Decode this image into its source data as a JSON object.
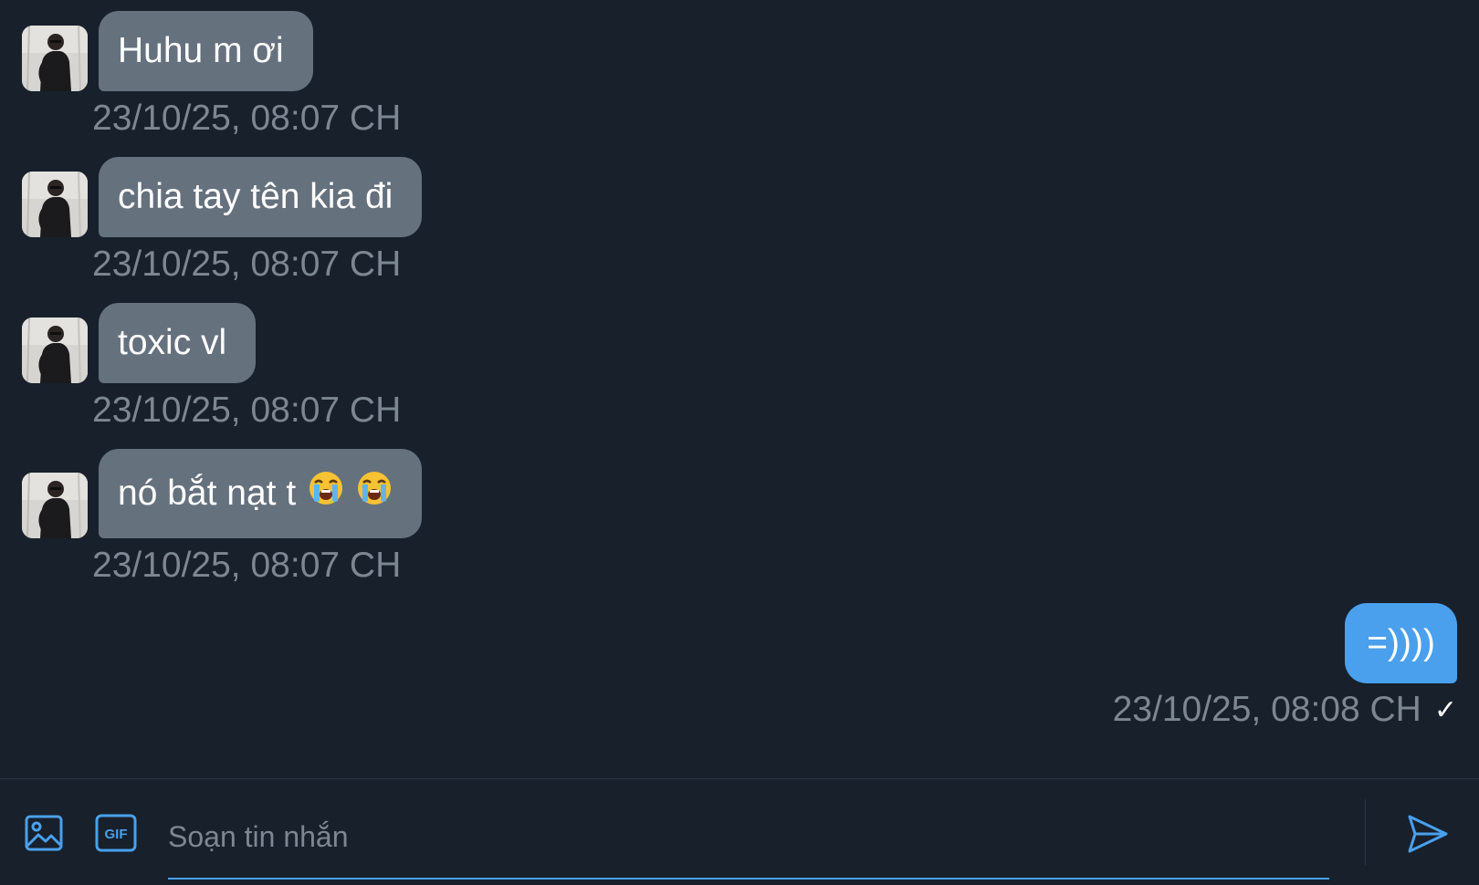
{
  "thread": {
    "incoming": [
      {
        "text": "Huhu m ơi",
        "timestamp": "23/10/25, 08:07 CH"
      },
      {
        "text": "chia tay tên kia đi",
        "timestamp": "23/10/25, 08:07 CH"
      },
      {
        "text": "toxic vl",
        "timestamp": "23/10/25, 08:07 CH"
      },
      {
        "text": "nó bắt nạt t",
        "emoji": [
          "loudly-crying-face",
          "loudly-crying-face"
        ],
        "timestamp": "23/10/25, 08:07 CH"
      }
    ],
    "outgoing": [
      {
        "text": "=))))",
        "timestamp": "23/10/25, 08:08 CH",
        "status": "✓"
      }
    ]
  },
  "composer": {
    "placeholder": "Soạn tin nhắn",
    "value": "",
    "gif_label": "GIF",
    "icons": [
      "image-icon",
      "gif-icon",
      "send-icon"
    ]
  },
  "colors": {
    "background": "#17202b",
    "incoming_bubble": "#66717e",
    "outgoing_bubble": "#4aa0ec",
    "timestamp": "#7d8792",
    "accent": "#4aa0ec"
  }
}
